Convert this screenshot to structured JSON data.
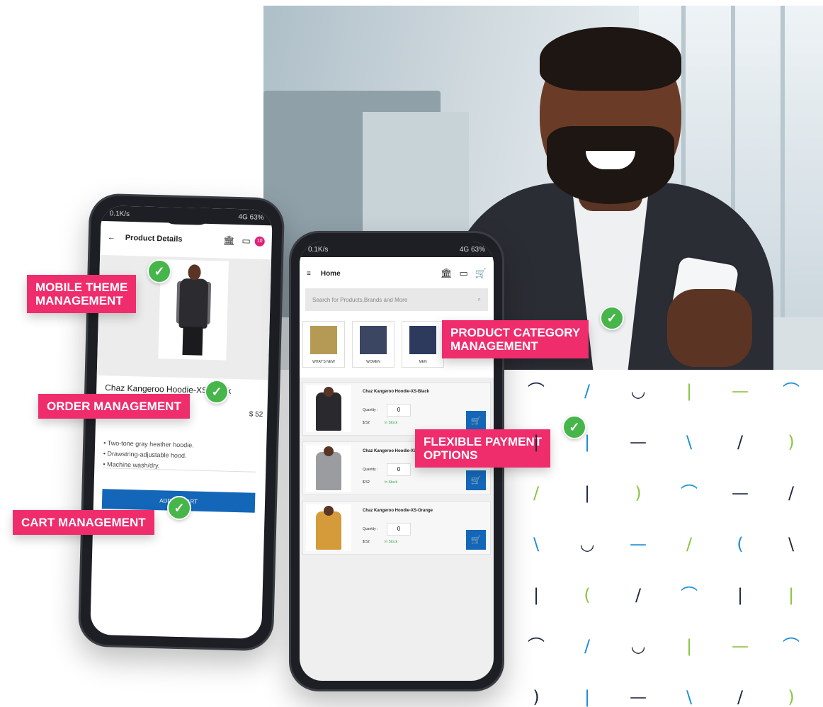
{
  "colors": {
    "tag_bg": "#ef2d6c",
    "check_green": "#46b54a",
    "button_blue": "#1466b8",
    "in_stock_green": "#35a853",
    "pattern_navy": "#1f2a44",
    "pattern_blue": "#1d8fd6",
    "pattern_green": "#8cc63f"
  },
  "feature_tags": {
    "mobile_theme": "MOBILE THEME\nMANAGEMENT",
    "order": "ORDER MANAGEMENT",
    "cart": "CART MANAGEMENT",
    "product_category": "PRODUCT CATEGORY\nMANAGEMENT",
    "payment": "FLEXIBLE PAYMENT\nOPTIONS",
    "check_icon": "checkmark-icon"
  },
  "phone1": {
    "status": {
      "left": "0.1K/s",
      "right": "4G 63%"
    },
    "header_title": "Product Details",
    "back_icon": "arrow-left-icon",
    "bank_icon": "bank-icon",
    "card_icon": "credit-card-icon",
    "cart_icon": "cart-icon",
    "cart_badge": "10",
    "product_name": "Chaz Kangeroo Hoodie-XS-Black",
    "price": "$ 52",
    "description": [
      "• Two-tone gray heather hoodie.",
      "• Drawstring-adjustable hood.",
      "• Machine wash/dry."
    ],
    "add_to_cart": "ADD TO CART"
  },
  "phone2": {
    "status": {
      "left": "0.1K/s",
      "right": "4G 63%"
    },
    "header_title": "Home",
    "menu_icon": "hamburger-menu-icon",
    "search_placeholder": "Search for Products,Brands and More",
    "categories": [
      {
        "label": "WHAT'S NEW"
      },
      {
        "label": "WOMEN"
      },
      {
        "label": "MEN"
      }
    ],
    "products": [
      {
        "name": "Chaz Kangeroo Hoodie-XS-Black",
        "quantity_label": "Quantity :",
        "quantity": "0",
        "price": "$ 52",
        "stock": "In Stock",
        "color": "#2a2a2e"
      },
      {
        "name": "Chaz Kangeroo Hoodie-XS-G",
        "quantity_label": "Quantity :",
        "quantity": "0",
        "price": "$ 52",
        "stock": "In Stock",
        "color": "#9b9ca0"
      },
      {
        "name": "Chaz Kangeroo Hoodie-XS-Orange",
        "quantity_label": "Quantity :",
        "quantity": "0",
        "price": "$ 52",
        "stock": "In Stock",
        "color": "#d59a3a"
      }
    ]
  }
}
